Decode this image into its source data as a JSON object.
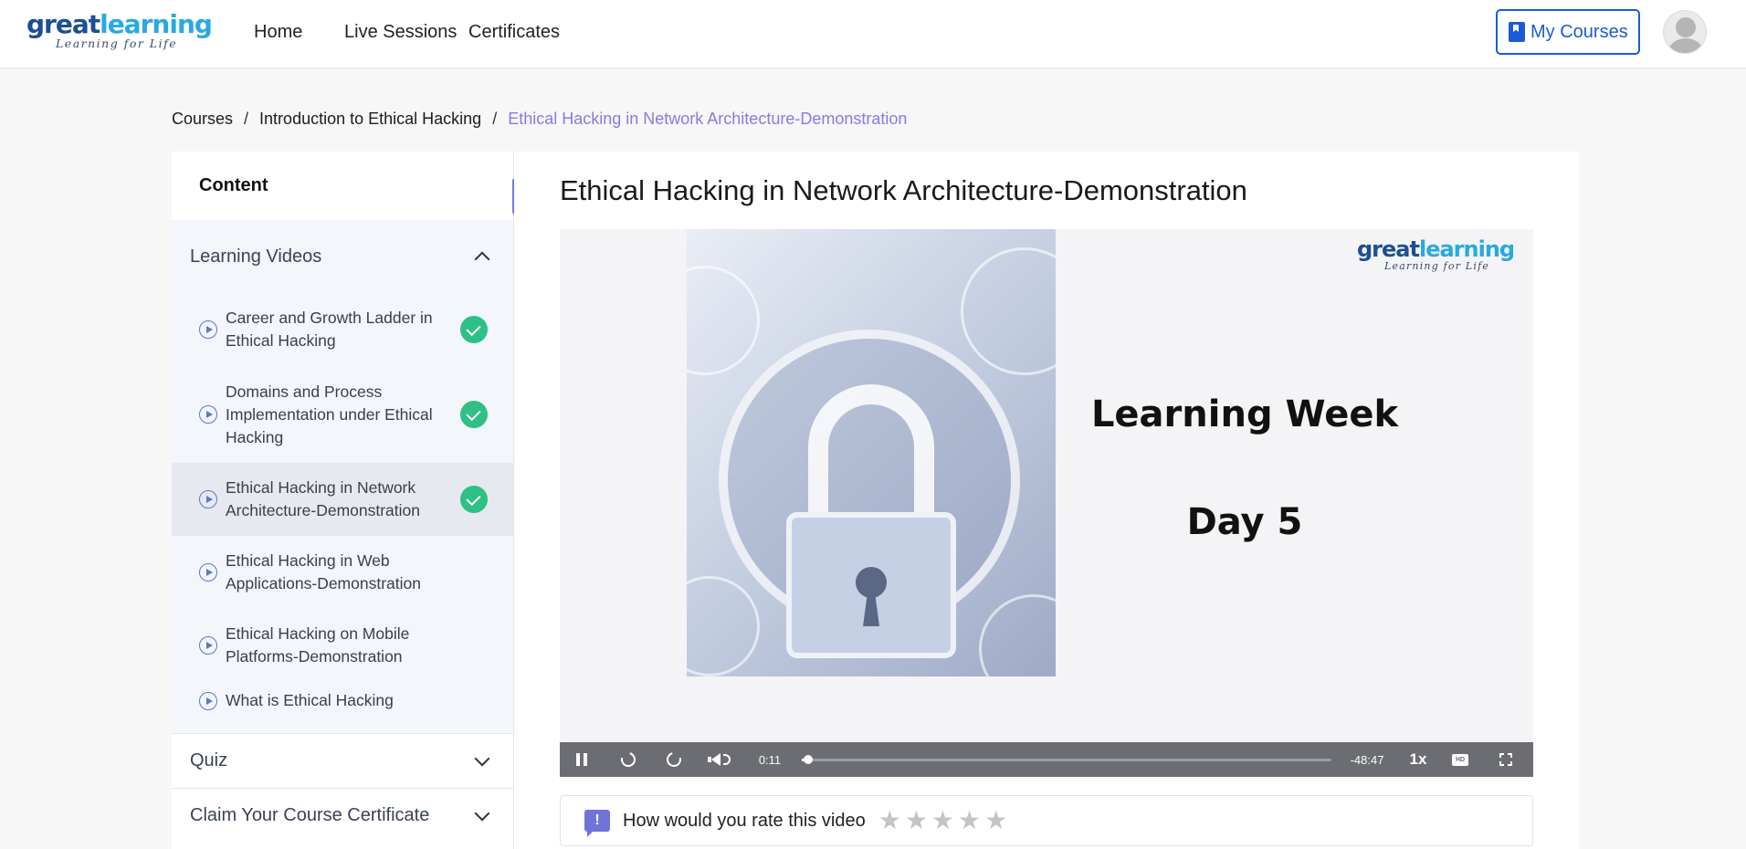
{
  "header": {
    "logo_primary_a": "great",
    "logo_primary_b": "learning",
    "logo_tagline": "Learning for Life",
    "nav": [
      "Home",
      "Live Sessions",
      "Certificates"
    ],
    "my_courses": "My Courses"
  },
  "breadcrumb": {
    "items": [
      "Courses",
      "Introduction to Ethical Hacking",
      "Ethical Hacking in Network Architecture-Demonstration"
    ],
    "separator": "/"
  },
  "sidebar": {
    "title": "Content",
    "section_learning": "Learning Videos",
    "items": [
      {
        "label": "Career and Growth Ladder in Ethical Hacking",
        "completed": true
      },
      {
        "label": "Domains and Process Implementation under Ethical Hacking",
        "completed": true
      },
      {
        "label": "Ethical Hacking in Network Architecture-Demonstration",
        "completed": true
      },
      {
        "label": "Ethical Hacking in Web Applications-Demonstration",
        "completed": false
      },
      {
        "label": "Ethical Hacking on Mobile Platforms-Demonstration",
        "completed": false
      },
      {
        "label": "What is Ethical Hacking",
        "completed": false
      }
    ],
    "section_quiz": "Quiz",
    "section_certificate": "Claim Your Course Certificate",
    "collapse_glyph": "«"
  },
  "main": {
    "title": "Ethical Hacking in Network Architecture-Demonstration",
    "video": {
      "slide_line1": "Learning Week",
      "slide_line2": "Day 5",
      "logo_a": "great",
      "logo_b": "learning",
      "logo_tagline": "Learning for Life",
      "current_time": "0:11",
      "remaining_time": "-48:47",
      "speed": "1x",
      "hd": "HD",
      "progress_fraction": 0.004
    },
    "rating": {
      "icon": "!",
      "prompt": "How would you rate this video",
      "stars": [
        "★",
        "★",
        "★",
        "★",
        "★"
      ]
    }
  },
  "colors": {
    "accent": "#1d5bd6",
    "breadcrumb_current": "#8a7be0",
    "complete": "#2ec084",
    "collapse": "#6f7ce6"
  }
}
